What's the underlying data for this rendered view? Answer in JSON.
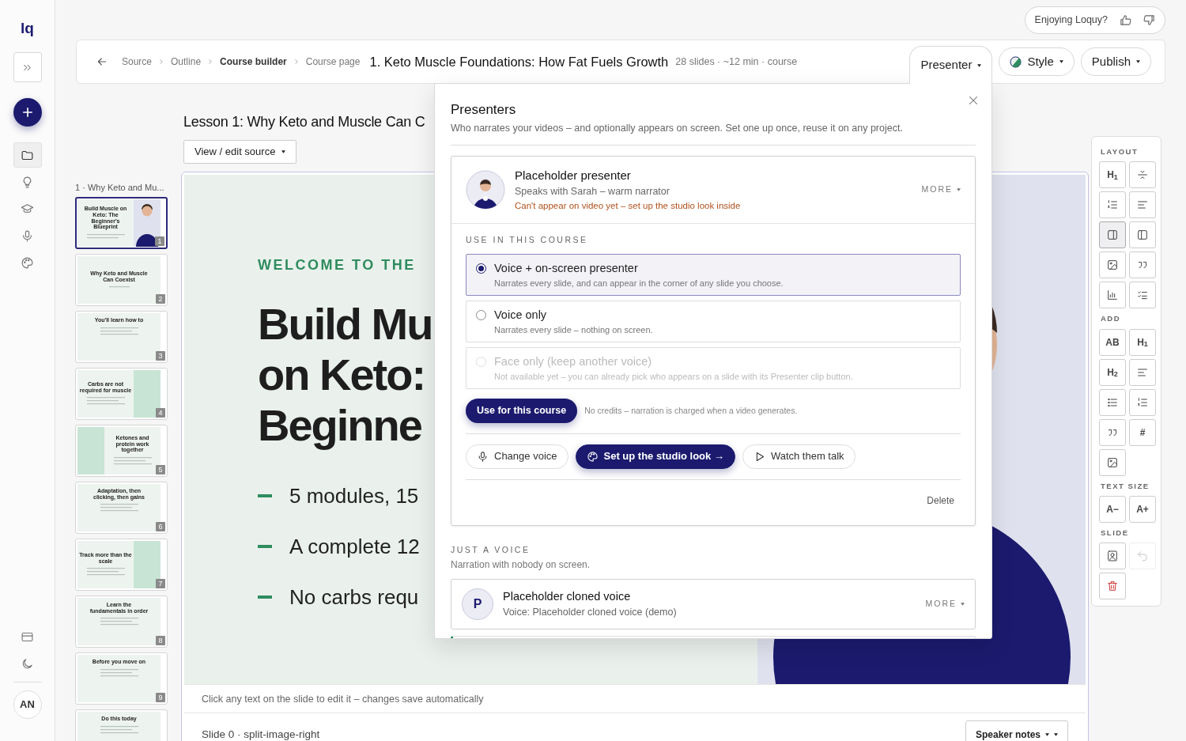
{
  "rail": {
    "logo": "lq",
    "tools": [
      {
        "kind": "expand"
      },
      {
        "kind": "create"
      }
    ],
    "nav": [
      {
        "kind": "folder",
        "selected": true
      },
      {
        "kind": "bulb",
        "selected": false
      },
      {
        "kind": "cap",
        "selected": false
      },
      {
        "kind": "mic",
        "selected": false
      },
      {
        "kind": "palette",
        "selected": false
      }
    ],
    "bottom": [
      {
        "kind": "card"
      },
      {
        "kind": "moon"
      }
    ],
    "avatar": "AN"
  },
  "feedback": {
    "label": "Enjoying Loquy?"
  },
  "header": {
    "breadcrumbs": [
      {
        "label": "Source",
        "selected": false
      },
      {
        "label": "Outline",
        "selected": false
      },
      {
        "label": "Course builder",
        "selected": true
      },
      {
        "label": "Course page",
        "selected": false
      }
    ],
    "title": "1. Keto Muscle Foundations: How Fat Fuels Growth",
    "meta": "28 slides · ~12 min · course",
    "actions": [
      {
        "label": "Presenter",
        "kind": "tab",
        "open": true
      },
      {
        "label": "Style",
        "kind": "style"
      },
      {
        "label": "Publish",
        "kind": "plain"
      }
    ]
  },
  "lesson": {
    "title": "Lesson 1: Why Keto and Muscle Can C",
    "source_button": "View / edit source"
  },
  "outline": {
    "section": "1 · Why Keto and Mu...",
    "thumbnails": [
      {
        "number": "1",
        "title": "Build Muscle on Keto: The Beginner's Blueprint",
        "kind": "presenter",
        "selected": true
      },
      {
        "number": "2",
        "title": "Why Keto and Muscle Can Coexist",
        "kind": "title",
        "selected": false
      },
      {
        "number": "3",
        "title": "You'll learn how to",
        "kind": "list",
        "selected": false
      },
      {
        "number": "4",
        "title": "Carbs are not required for muscle",
        "kind": "image-right",
        "selected": false
      },
      {
        "number": "5",
        "title": "Ketones and protein work together",
        "kind": "image-left",
        "selected": false
      },
      {
        "number": "6",
        "title": "Adaptation, then clicking, then gains",
        "kind": "list",
        "selected": false
      },
      {
        "number": "7",
        "title": "Track more than the scale",
        "kind": "image-right",
        "selected": false
      },
      {
        "number": "8",
        "title": "Learn the fundamentals in order",
        "kind": "list",
        "selected": false
      },
      {
        "number": "9",
        "title": "Before you move on",
        "kind": "list",
        "selected": false
      },
      {
        "title": "Do this today",
        "kind": "list",
        "selected": false
      }
    ]
  },
  "slide": {
    "eyebrow": "WELCOME TO THE",
    "heading": [
      "Build Mu",
      "on Keto:",
      "Beginne"
    ],
    "bullets": [
      "5 modules, 15",
      "A complete 12",
      "No carbs requ"
    ],
    "hint": "Click any text on the slide to edit it – changes save automatically",
    "footer": "Slide 0 · split-image-right",
    "notes_button": "Speaker notes"
  },
  "toolbar": {
    "groups": [
      {
        "label": "LAYOUT",
        "items": [
          {
            "kind": "label",
            "label": "H$_{1}$",
            "selected": false
          },
          {
            "kind": "align-middle",
            "selected": false
          },
          {
            "kind": "numbered",
            "selected": false
          },
          {
            "kind": "lines",
            "selected": false
          },
          {
            "kind": "split-right",
            "selected": true
          },
          {
            "kind": "split-left",
            "selected": false
          },
          {
            "kind": "image",
            "selected": false
          },
          {
            "kind": "quote",
            "selected": false
          },
          {
            "kind": "chart",
            "selected": false
          },
          {
            "kind": "checklist",
            "selected": false
          }
        ]
      },
      {
        "label": "ADD",
        "items": [
          {
            "kind": "label",
            "label": "AB"
          },
          {
            "kind": "label",
            "label": "H$_{1}$"
          },
          {
            "kind": "label",
            "label": "H$_{2}$"
          },
          {
            "kind": "lines"
          },
          {
            "kind": "bullets"
          },
          {
            "kind": "numbered"
          },
          {
            "kind": "quote"
          },
          {
            "kind": "label",
            "label": "#"
          },
          {
            "kind": "image"
          }
        ]
      },
      {
        "label": "TEXT SIZE",
        "items": [
          {
            "kind": "label",
            "label": "A−"
          },
          {
            "kind": "label",
            "label": "A+"
          }
        ]
      },
      {
        "label": "SLIDE",
        "items": [
          {
            "kind": "portrait",
            "disabled": false
          },
          {
            "kind": "undo",
            "disabled": true
          },
          {
            "kind": "trash",
            "disabled": false
          }
        ]
      }
    ]
  },
  "popup": {
    "title": "Presenters",
    "subtitle": "Who narrates your videos – and optionally appears on screen. Set one up once, reuse it on any project.",
    "presenter": {
      "name": "Placeholder presenter",
      "voice": "Speaks with Sarah – warm narrator",
      "warning": "Can't appear on video yet – set up the studio look inside",
      "more": "MORE",
      "section": "USE IN THIS COURSE",
      "options": [
        {
          "title": "Voice + on-screen presenter",
          "description": "Narrates every slide, and can appear in the corner of any slide you choose.",
          "selected": true,
          "disabled": false
        },
        {
          "title": "Voice only",
          "description": "Narrates every slide – nothing on screen.",
          "selected": false,
          "disabled": false
        },
        {
          "title": "Face only (keep another voice)",
          "description": "Not available yet – you can already pick who appears on a slide with its Presenter clip button.",
          "selected": false,
          "disabled": true
        }
      ],
      "use_button": "Use for this course",
      "note": "No credits – narration is charged when a video generates.",
      "actions": [
        {
          "kind": "mic",
          "label": "Change voice",
          "primary": false
        },
        {
          "kind": "palette",
          "label": "Set up the studio look →",
          "primary": true
        },
        {
          "kind": "play",
          "label": "Watch them talk",
          "primary": false
        }
      ],
      "delete": "Delete"
    },
    "voice_section": {
      "label": "JUST A VOICE",
      "description": "Narration with nobody on screen.",
      "voices": [
        {
          "kind": "voice",
          "initial": "P",
          "name": "Placeholder cloned voice",
          "detail": "Voice: Placeholder cloned voice (demo)",
          "more": "MORE"
        },
        {
          "kind": "partial"
        }
      ]
    }
  }
}
